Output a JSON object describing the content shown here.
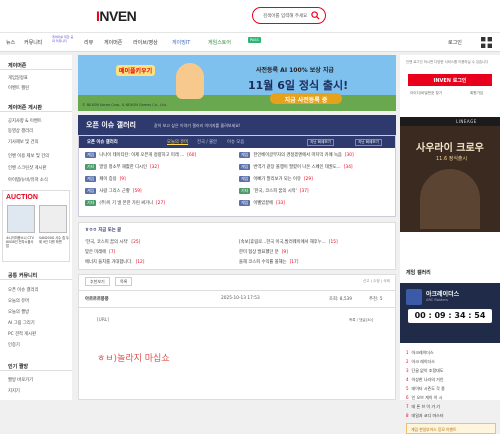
{
  "header": {
    "logo": "INVEN",
    "logo_i": "I",
    "logo_rest": "NVEN",
    "search_placeholder": "검색어를 입력해 주세요"
  },
  "nav": {
    "left": [
      "뉴스",
      "커뮤니티"
    ],
    "tagline": "게이머를 위한 공략 커뮤니티",
    "items": [
      "리뷰",
      "게이머존",
      "라이브/영상",
      "게이밍IT",
      "게임스토어"
    ],
    "pass_badge": "PASS",
    "right": [
      "로그인"
    ]
  },
  "leftbar": {
    "sec1": "게이머존",
    "sec1_items": [
      "게임일정표",
      "이벤트 캘린"
    ],
    "sec2": "게이머존 게시판",
    "sec2_items": [
      "공지사항 & 이벤트",
      "동영상 갤러리",
      "기사제보 및 건의",
      "인벤 이용 제보 및 건의",
      "인벤 스크린샷 게시판",
      "아이템/뉴비/유저 소식",
      "정보/방명록"
    ],
    "auction_title": "AUCTION",
    "auction_left": "소니이미용소니 CTV 60GB인 전자시음사 탑",
    "auction_right": "SAN200G 사수 칩 두 제 9인 다를 하면",
    "sec3": "공통 커뮤니티",
    "sec3_items": [
      "오픈 이슈 갤러리",
      "오늘의 유머",
      "오늘의 짤방",
      "AI 그림 그리기",
      "PC 견적 게시판",
      "인증기"
    ],
    "sec4": "인기 짤방",
    "sec4_items": [
      "짤방 바로가기",
      "지지기"
    ]
  },
  "banner": {
    "game": "메이플키우기",
    "title": "사전등록 AI 100% 보상 지급",
    "big": "11월 6일 정식 출시!",
    "cta": "지금 사전등록 중",
    "small": "© NEXON Korea Corp. & NEXON Games Co., Ltd."
  },
  "gbar": {
    "title": "오픈 이슈 갤러리",
    "sub": "같이 보고 싶은 이야기 갤러리 이미지를 올려보세요!"
  },
  "issue": {
    "tabs": [
      "오픈 이슈 갤러리",
      "오늘의 유머",
      "전국 / 불안",
      "이슈 모음"
    ],
    "more": [
      "지난 화제보기",
      "지난 화제보기"
    ],
    "left_rows": [
      {
        "tag": "게임",
        "title": "나나이 테이티탄: 이제 오픈게 정량하고 미래 ...",
        "cnt": "[60]"
      },
      {
        "tag": "기타",
        "title": "말일 청소부 재활한 디시인",
        "cnt": "[32]"
      },
      {
        "tag": "게임",
        "title": "페이 증용",
        "cnt": "[9]"
      },
      {
        "tag": "게임",
        "title": "사랑 그리스 근황",
        "cnt": "[59]"
      },
      {
        "tag": "기타",
        "title": "(주)이 기 낼 본한 가린 써거니",
        "cnt": "[27]"
      }
    ],
    "right_rows": [
      {
        "tag": "게임",
        "title": "한인베이글부자의 경정겠엔에서 마지막 카페 녹음",
        "cnt": "[30]"
      },
      {
        "tag": "게임",
        "title": "번역기 같장 올챙이 팔렸어 나온 스페인 태권도...",
        "cnt": "[34]"
      },
      {
        "tag": "게임",
        "title": "이빠가 말리보가 되는 이유",
        "cnt": "[29]"
      },
      {
        "tag": "기타",
        "title": "'한국, 코스피 꿈의 시작'",
        "cnt": "[37]"
      },
      {
        "tag": "게임",
        "title": "이빨있끝에",
        "cnt": "[33]"
      }
    ]
  },
  "hot": {
    "title": "ㅎㅇㅇ 지금 또는 글",
    "left": [
      {
        "title": "'한국, 코스피 꿈의 시작'",
        "cnt": "[25]"
      },
      {
        "title": "맞은 미레에",
        "cnt": "[7]"
      },
      {
        "title": "에너지 들치를 거대합니다.",
        "cnt": "[12]"
      }
    ],
    "right": [
      {
        "title": "[속보]휴림로...한국 이국,발러웨이에서 해후누...",
        "cnt": "[15]"
      },
      {
        "title": "한미 협상 발표했던 분",
        "cnt": "[9]"
      },
      {
        "title": "을해 코스피 수익률 올해는",
        "cnt": "[17]"
      }
    ]
  },
  "board": {
    "buttons": [
      "추천보기",
      "목록"
    ],
    "small_right": "신고 | 수정 | 삭제",
    "author": "아르르르몽몽",
    "date": "2025-10-13 17:53",
    "views": "조회: 8,539",
    "rec": "추천: 5",
    "url_label": "[URL]",
    "share": "목록 / 댓글[30]",
    "content": "ㅎㅂ)놀라지 마십쇼"
  },
  "right": {
    "notice": "인벤 로그인 하시면 다양한 서비스를 이용하실 수 있습니다",
    "login": "INVEN 로그인",
    "sub_left": "아이디/비밀번호 찾기",
    "sub_right": "회원가입",
    "ad_title": "사우라이 크로우",
    "ad_sub": "11.6 정식출시",
    "ad_brand": "LINEAGE",
    "gal_title": "게임 갤러리",
    "gal_game": "아크레이더스",
    "gal_game_sub": "ARC Raiders",
    "timer": "00 : 09 : 34 : 54",
    "ranks": [
      "아크레이더스",
      "아크 레이더스",
      "단골 없이 조정대도",
      "이상한 나라의 거인",
      "데이터 시즌도 각 종",
      "인 오브 게이 이 시",
      "데 폰 브 이 가 기",
      "데일과 코디 마스터"
    ],
    "event": "게임 한일부어스 응모 이벤트"
  },
  "colors": {
    "brand": "#e8001c",
    "navy": "#2e3a6e",
    "gold": "#e6a21a",
    "content": "#d9534f"
  }
}
